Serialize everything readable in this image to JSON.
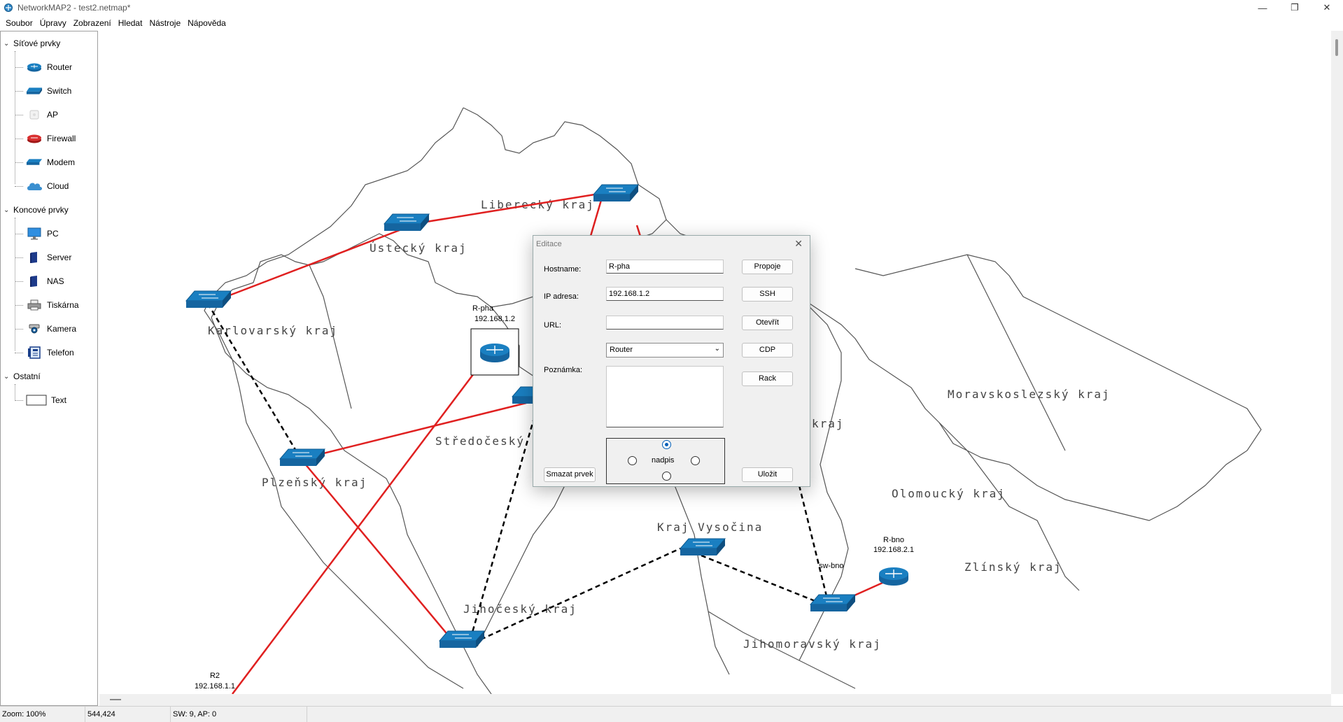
{
  "window": {
    "title": "NetworkMAP2 - test2.netmap*",
    "minimize_glyph": "—",
    "maximize_glyph": "❐",
    "close_glyph": "✕"
  },
  "menu": [
    "Soubor",
    "Úpravy",
    "Zobrazení",
    "Hledat",
    "Nástroje",
    "Nápověda"
  ],
  "sidebar": {
    "groups": [
      {
        "label": "Síťové prvky",
        "items": [
          {
            "label": "Router",
            "icon": "router-icon"
          },
          {
            "label": "Switch",
            "icon": "switch-icon"
          },
          {
            "label": "AP",
            "icon": "access-point-icon"
          },
          {
            "label": "Firewall",
            "icon": "firewall-icon"
          },
          {
            "label": "Modem",
            "icon": "modem-icon"
          },
          {
            "label": "Cloud",
            "icon": "cloud-icon"
          }
        ]
      },
      {
        "label": "Koncové prvky",
        "items": [
          {
            "label": "PC",
            "icon": "pc-icon"
          },
          {
            "label": "Server",
            "icon": "server-icon"
          },
          {
            "label": "NAS",
            "icon": "nas-icon"
          },
          {
            "label": "Tiskárna",
            "icon": "printer-icon"
          },
          {
            "label": "Kamera",
            "icon": "camera-icon"
          },
          {
            "label": "Telefon",
            "icon": "phone-icon"
          }
        ]
      },
      {
        "label": "Ostatní",
        "items": [
          {
            "label": "Text",
            "icon": "text-box-icon"
          }
        ]
      }
    ]
  },
  "map": {
    "regions": [
      "Liberecký kraj",
      "Ústecký kraj",
      "Karlovarský kraj",
      "Středočeský kraj",
      "Plzeňský kraj",
      "Jihočeský kraj",
      "Kraj Vysočina",
      "Jihomoravský kraj",
      "Olomoucký kraj",
      "Zlínský kraj",
      "Moravskoslezský kraj",
      "kraj"
    ],
    "nodes": {
      "r_pha": {
        "name": "R-pha",
        "ip": "192.168.1.2"
      },
      "r_bno": {
        "name": "R-bno",
        "ip": "192.168.2.1"
      },
      "r2": {
        "name": "R2",
        "ip": "192.168.1.1"
      },
      "sw_bno": {
        "name": "sw-bno"
      }
    },
    "link_colors": {
      "solid": "#e02020",
      "dashed": "#000000"
    }
  },
  "dialog": {
    "title": "Editace",
    "close_glyph": "✕",
    "hostname_label": "Hostname:",
    "hostname_value": "R-pha",
    "ip_label": "IP adresa:",
    "ip_value": "192.168.1.2",
    "url_label": "URL:",
    "url_value": "",
    "type_value": "Router",
    "note_label": "Poznámka:",
    "buttons": {
      "propoje": "Propoje",
      "ssh": "SSH",
      "otevrit": "Otevřít",
      "cdp": "CDP",
      "rack": "Rack",
      "ulozit": "Uložit",
      "smazat": "Smazat prvek"
    },
    "label_position": {
      "label": "nadpis",
      "selected": "top"
    }
  },
  "status": {
    "zoom": "Zoom: 100%",
    "coords": "544,424",
    "counts": "SW: 9, AP: 0"
  },
  "colors": {
    "device_blue": "#1a7fc1",
    "accent": "#005fb8"
  }
}
